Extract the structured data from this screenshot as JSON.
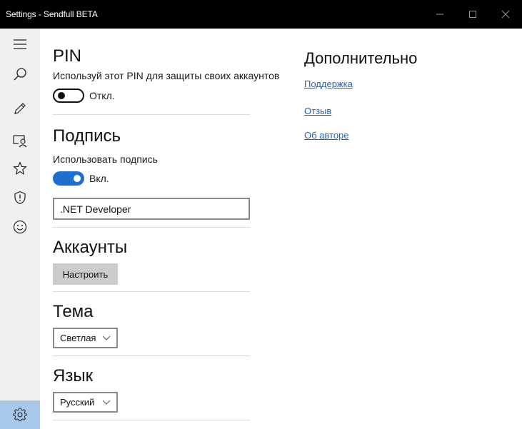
{
  "window": {
    "title": "Settings - Sendfull BETA"
  },
  "sidebar": {
    "items": [
      {
        "icon": "hamburger-menu-icon"
      },
      {
        "icon": "search-icon"
      },
      {
        "icon": "pencil-icon"
      },
      {
        "icon": "contacts-icon"
      },
      {
        "icon": "star-icon"
      },
      {
        "icon": "shield-icon"
      },
      {
        "icon": "smiley-icon"
      }
    ],
    "settings": {
      "icon": "gear-icon",
      "active_color": "#a7c8ea"
    }
  },
  "pin": {
    "heading": "PIN",
    "description": "Используй этот PIN для защиты своих аккаунтов",
    "toggle_label": "Откл.",
    "toggle_on": false
  },
  "signature": {
    "heading": "Подпись",
    "description": "Использовать подпись",
    "toggle_label": "Вкл.",
    "toggle_on": true,
    "value": ".NET Developer"
  },
  "accounts": {
    "heading": "Аккаунты",
    "button_label": "Настроить"
  },
  "theme": {
    "heading": "Тема",
    "selected": "Светлая"
  },
  "language": {
    "heading": "Язык",
    "selected": "Русский"
  },
  "extra": {
    "heading": "Дополнительно",
    "links": [
      "Поддержка",
      "Отзыв",
      "Об авторе"
    ]
  },
  "colors": {
    "accent": "#1e6fd0",
    "link": "#1f63b5"
  }
}
